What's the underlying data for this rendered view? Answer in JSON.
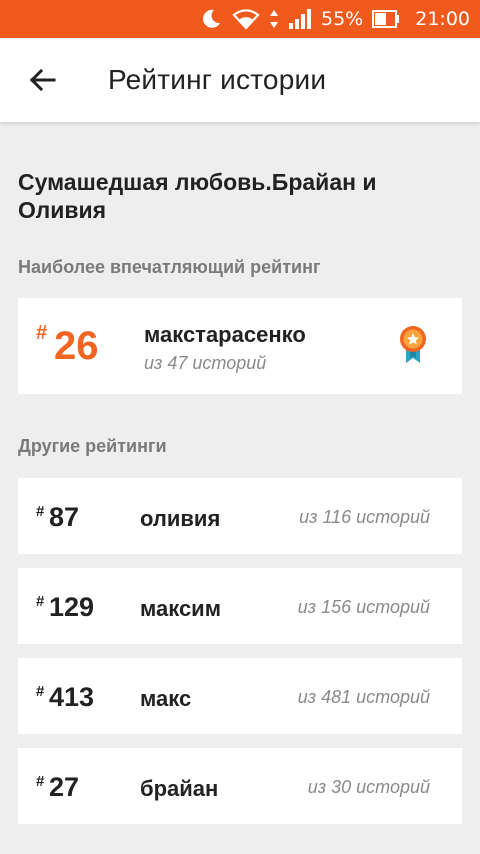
{
  "status_bar": {
    "icons": [
      "moon-icon",
      "wifi-icon",
      "data-arrows-icon",
      "signal-icon",
      "battery-icon"
    ],
    "battery_percent": "55%",
    "time": "21:00",
    "color": "#f15a1d"
  },
  "app_bar": {
    "back_icon": "arrow-left-icon",
    "title": "Рейтинг истории"
  },
  "story": {
    "title": "Сумашедшая любовь.Брайан и Оливия"
  },
  "best_rating": {
    "section_label": "Наиболее впечатляющий рейтинг",
    "hash": "#",
    "rank": "26",
    "name": "макстарасенко",
    "of_text": "из 47 историй",
    "badge_icon": "medal-icon",
    "accent_color": "#f26522"
  },
  "other_ratings": {
    "section_label": "Другие рейтинги",
    "items": [
      {
        "hash": "#",
        "rank": "87",
        "name": "оливия",
        "of_text": "из 116 историй"
      },
      {
        "hash": "#",
        "rank": "129",
        "name": "максим",
        "of_text": "из 156 историй"
      },
      {
        "hash": "#",
        "rank": "413",
        "name": "макс",
        "of_text": "из 481 историй"
      },
      {
        "hash": "#",
        "rank": "27",
        "name": "брайан",
        "of_text": "из 30 историй"
      }
    ]
  }
}
